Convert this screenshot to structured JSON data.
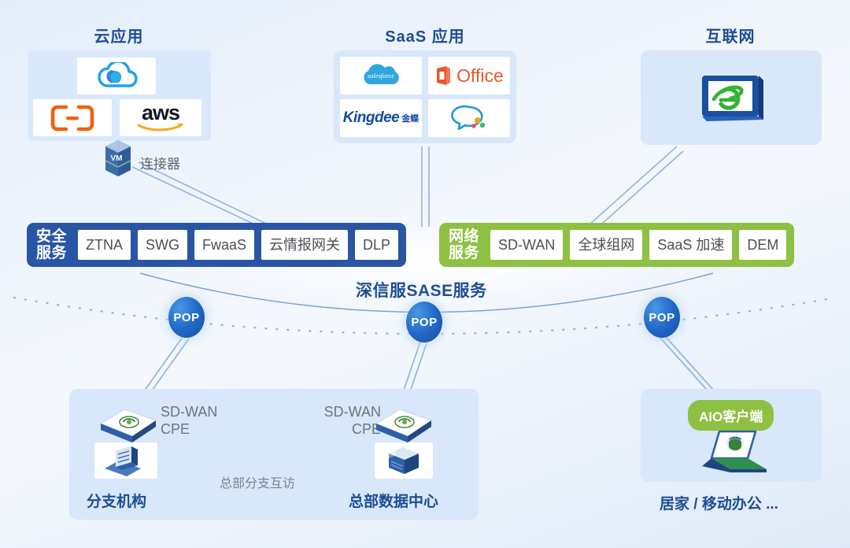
{
  "diagram": {
    "center_label": "深信服SASE服务"
  },
  "groups": {
    "cloud_apps": {
      "title": "云应用",
      "logos": [
        {
          "name": "tencent-cloud",
          "label": ""
        },
        {
          "name": "alibaba-cloud",
          "label": ""
        },
        {
          "name": "aws",
          "label": "aws"
        }
      ],
      "connector": {
        "icon_label": "VM",
        "label": "连接器"
      }
    },
    "saas_apps": {
      "title": "SaaS 应用",
      "logos": [
        {
          "name": "salesforce",
          "label": "salesforce"
        },
        {
          "name": "microsoft-office",
          "label": "Office"
        },
        {
          "name": "kingdee",
          "label": "Kingdee",
          "label_cn": "金蝶"
        },
        {
          "name": "wecom",
          "label": ""
        }
      ]
    },
    "internet": {
      "title": "互联网",
      "logos": [
        {
          "name": "internet-explorer-browser",
          "label": "e"
        }
      ]
    }
  },
  "security_services": {
    "label": "安全\n服务",
    "label_line1": "安全",
    "label_line2": "服务",
    "color": "#2a55a4",
    "items": [
      "ZTNA",
      "SWG",
      "FwaaS",
      "云情报网关",
      "DLP"
    ]
  },
  "network_services": {
    "label_line1": "网络",
    "label_line2": "服务",
    "color": "#8ec043",
    "items": [
      "SD-WAN",
      "全球组网",
      "SaaS 加速",
      "DEM"
    ]
  },
  "pops": [
    {
      "label": "POP"
    },
    {
      "label": "POP"
    },
    {
      "label": "POP"
    }
  ],
  "sites": {
    "branch": {
      "device_label_line1": "SD-WAN",
      "device_label_line2": "CPE",
      "name": "分支机构"
    },
    "headquarters": {
      "device_label_line1": "SD-WAN",
      "device_label_line2": "CPE",
      "name": "总部数据中心"
    },
    "interlink_label": "总部分支互访",
    "remote": {
      "badge": "AIO客户端",
      "name": "居家 / 移动办公 ..."
    }
  }
}
